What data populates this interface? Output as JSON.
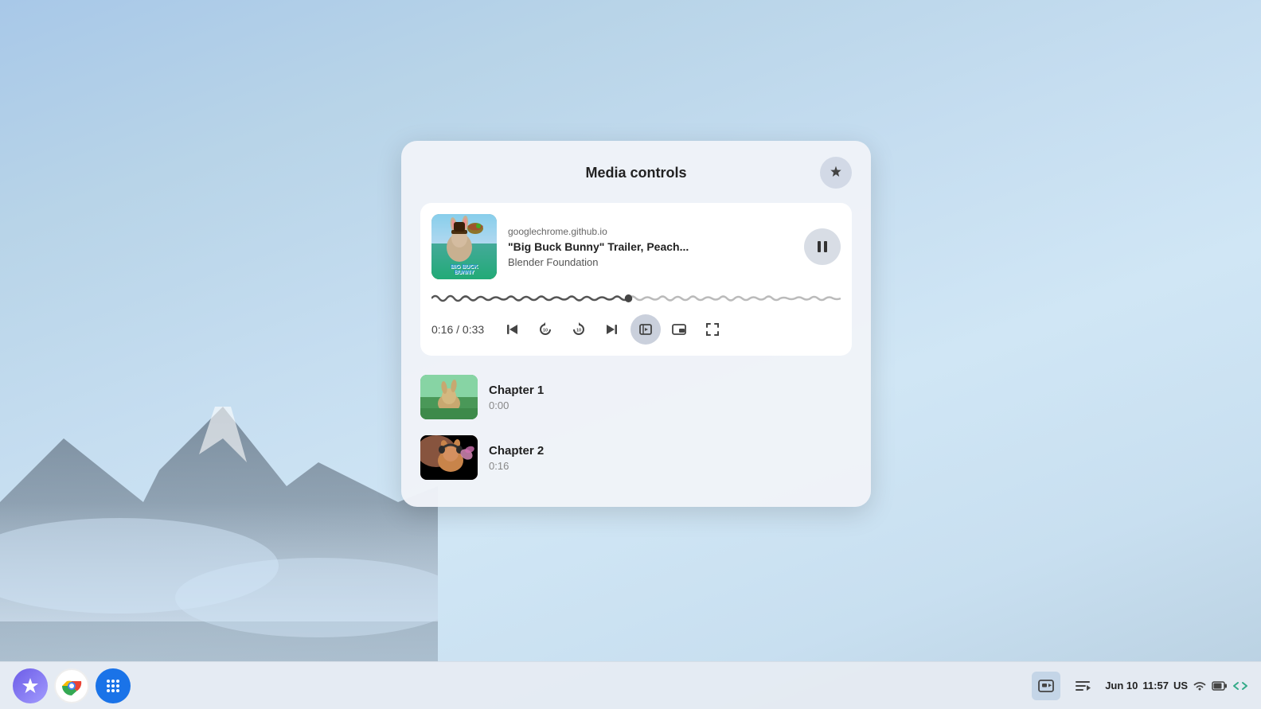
{
  "desktop": {
    "background": "sky-mountains"
  },
  "media_panel": {
    "title": "Media controls",
    "pin_label": "pin",
    "media_card": {
      "source": "googlechrome.github.io",
      "title": "\"Big Buck Bunny\" Trailer, Peach...",
      "artist": "Blender Foundation",
      "current_time": "0:16",
      "total_time": "0:33",
      "time_display": "0:16 / 0:33",
      "progress_percent": 48
    },
    "controls": {
      "skip_back_label": "skip to beginning",
      "rewind_label": "rewind 10s",
      "forward_label": "forward 10s",
      "skip_forward_label": "skip forward",
      "chapters_label": "chapters",
      "pip_label": "picture in picture",
      "fullscreen_label": "fullscreen"
    },
    "chapters": [
      {
        "name": "Chapter 1",
        "time": "0:00"
      },
      {
        "name": "Chapter 2",
        "time": "0:16"
      }
    ]
  },
  "taskbar": {
    "apps": [
      {
        "id": "launcher",
        "label": "Launcher"
      },
      {
        "id": "chrome",
        "label": "Google Chrome"
      },
      {
        "id": "app-drawer",
        "label": "App Drawer"
      }
    ],
    "right": {
      "media_icon": "media",
      "queue_icon": "queue",
      "date": "Jun 10",
      "time": "11:57",
      "locale": "US"
    }
  }
}
